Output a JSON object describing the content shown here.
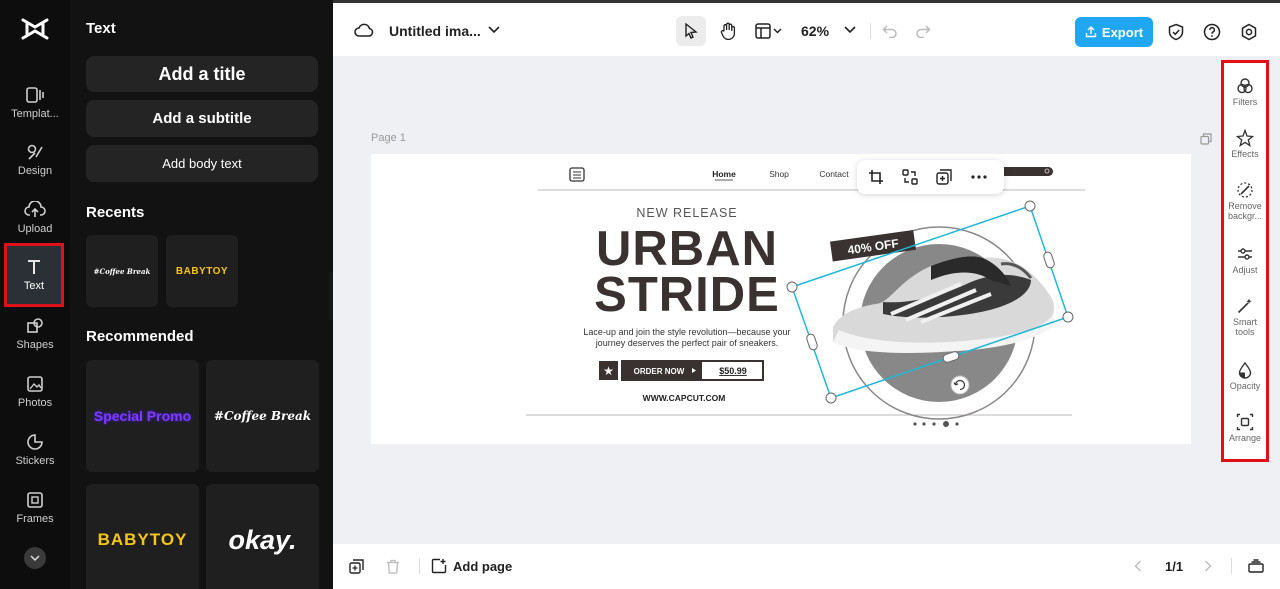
{
  "rail": {
    "items": [
      {
        "label": "Templat..."
      },
      {
        "label": "Design"
      },
      {
        "label": "Upload"
      },
      {
        "label": "Text"
      },
      {
        "label": "Shapes"
      },
      {
        "label": "Photos"
      },
      {
        "label": "Stickers"
      },
      {
        "label": "Frames"
      }
    ]
  },
  "panel": {
    "title": "Text",
    "add_title": "Add a title",
    "add_subtitle": "Add a subtitle",
    "add_body": "Add body text",
    "recents_label": "Recents",
    "recents": [
      "#Coffee Break",
      "BABYTOY"
    ],
    "recommended_label": "Recommended",
    "recommended": [
      "Special Promo",
      "#Coffee Break",
      "BABYTOY",
      "okay."
    ]
  },
  "topbar": {
    "title": "Untitled ima...",
    "zoom": "62%",
    "export_label": "Export"
  },
  "canvas": {
    "page_label": "Page 1",
    "design": {
      "nav": [
        "Home",
        "Shop",
        "Contact"
      ],
      "eyebrow": "NEW RELEASE",
      "headline_1": "URBAN",
      "headline_2": "STRIDE",
      "body_1": "Lace-up and join the style revolution—because your",
      "body_2": "journey deserves the perfect pair of sneakers.",
      "cta": "ORDER NOW",
      "price": "$50.99",
      "url": "WWW.CAPCUT.COM",
      "badge": "40% OFF"
    }
  },
  "right_toolbar": {
    "items": [
      "Filters",
      "Effects",
      "Remove backgr...",
      "Adjust",
      "Smart tools",
      "Opacity",
      "Arrange"
    ]
  },
  "bottombar": {
    "add_page": "Add page",
    "page_count": "1/1"
  },
  "colors": {
    "accent": "#1fa7f2",
    "highlight": "#e0101a",
    "selection": "#1fb7d8",
    "brand_dark": "#3a3230"
  }
}
